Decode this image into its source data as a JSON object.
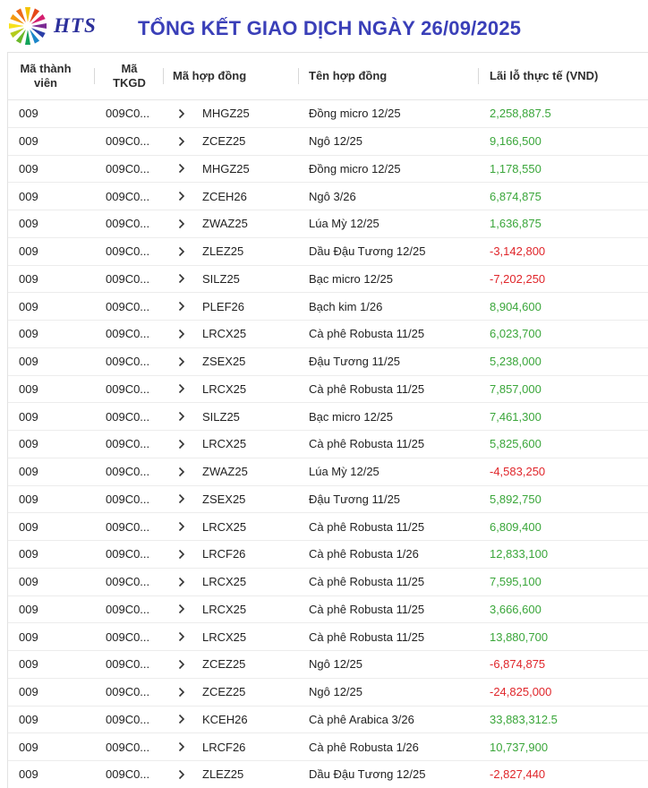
{
  "header": {
    "logo_text": "HTS",
    "title": "TỔNG KẾT GIAO DỊCH NGÀY 26/09/2025"
  },
  "columns": {
    "member": "Mã thành viên",
    "account": "Mã TKGD",
    "contract_code": "Mã hợp đồng",
    "contract_name": "Tên hợp đồng",
    "pnl": "Lãi lỗ thực tế (VND)"
  },
  "colors": {
    "positive": "#3aa63a",
    "negative": "#e0262b",
    "title": "#3a3fb8"
  },
  "rows": [
    {
      "member": "009",
      "account": "009C0...",
      "code": "MHGZ25",
      "name": "Đồng micro 12/25",
      "pnl": "2,258,887.5",
      "sign": "pos"
    },
    {
      "member": "009",
      "account": "009C0...",
      "code": "ZCEZ25",
      "name": "Ngô 12/25",
      "pnl": "9,166,500",
      "sign": "pos"
    },
    {
      "member": "009",
      "account": "009C0...",
      "code": "MHGZ25",
      "name": "Đồng micro 12/25",
      "pnl": "1,178,550",
      "sign": "pos"
    },
    {
      "member": "009",
      "account": "009C0...",
      "code": "ZCEH26",
      "name": "Ngô 3/26",
      "pnl": "6,874,875",
      "sign": "pos"
    },
    {
      "member": "009",
      "account": "009C0...",
      "code": "ZWAZ25",
      "name": "Lúa Mỳ 12/25",
      "pnl": "1,636,875",
      "sign": "pos"
    },
    {
      "member": "009",
      "account": "009C0...",
      "code": "ZLEZ25",
      "name": "Dầu Đậu Tương 12/25",
      "pnl": "-3,142,800",
      "sign": "neg"
    },
    {
      "member": "009",
      "account": "009C0...",
      "code": "SILZ25",
      "name": "Bạc micro 12/25",
      "pnl": "-7,202,250",
      "sign": "neg"
    },
    {
      "member": "009",
      "account": "009C0...",
      "code": "PLEF26",
      "name": "Bạch kim 1/26",
      "pnl": "8,904,600",
      "sign": "pos"
    },
    {
      "member": "009",
      "account": "009C0...",
      "code": "LRCX25",
      "name": "Cà phê Robusta 11/25",
      "pnl": "6,023,700",
      "sign": "pos"
    },
    {
      "member": "009",
      "account": "009C0...",
      "code": "ZSEX25",
      "name": "Đậu Tương 11/25",
      "pnl": "5,238,000",
      "sign": "pos"
    },
    {
      "member": "009",
      "account": "009C0...",
      "code": "LRCX25",
      "name": "Cà phê Robusta 11/25",
      "pnl": "7,857,000",
      "sign": "pos"
    },
    {
      "member": "009",
      "account": "009C0...",
      "code": "SILZ25",
      "name": "Bạc micro 12/25",
      "pnl": "7,461,300",
      "sign": "pos"
    },
    {
      "member": "009",
      "account": "009C0...",
      "code": "LRCX25",
      "name": "Cà phê Robusta 11/25",
      "pnl": "5,825,600",
      "sign": "pos"
    },
    {
      "member": "009",
      "account": "009C0...",
      "code": "ZWAZ25",
      "name": "Lúa Mỳ 12/25",
      "pnl": "-4,583,250",
      "sign": "neg"
    },
    {
      "member": "009",
      "account": "009C0...",
      "code": "ZSEX25",
      "name": "Đậu Tương 11/25",
      "pnl": "5,892,750",
      "sign": "pos"
    },
    {
      "member": "009",
      "account": "009C0...",
      "code": "LRCX25",
      "name": "Cà phê Robusta 11/25",
      "pnl": "6,809,400",
      "sign": "pos"
    },
    {
      "member": "009",
      "account": "009C0...",
      "code": "LRCF26",
      "name": "Cà phê Robusta 1/26",
      "pnl": "12,833,100",
      "sign": "pos"
    },
    {
      "member": "009",
      "account": "009C0...",
      "code": "LRCX25",
      "name": "Cà phê Robusta 11/25",
      "pnl": "7,595,100",
      "sign": "pos"
    },
    {
      "member": "009",
      "account": "009C0...",
      "code": "LRCX25",
      "name": "Cà phê Robusta 11/25",
      "pnl": "3,666,600",
      "sign": "pos"
    },
    {
      "member": "009",
      "account": "009C0...",
      "code": "LRCX25",
      "name": "Cà phê Robusta 11/25",
      "pnl": "13,880,700",
      "sign": "pos"
    },
    {
      "member": "009",
      "account": "009C0...",
      "code": "ZCEZ25",
      "name": "Ngô 12/25",
      "pnl": "-6,874,875",
      "sign": "neg"
    },
    {
      "member": "009",
      "account": "009C0...",
      "code": "ZCEZ25",
      "name": "Ngô 12/25",
      "pnl": "-24,825,000",
      "sign": "neg"
    },
    {
      "member": "009",
      "account": "009C0...",
      "code": "KCEH26",
      "name": "Cà phê Arabica 3/26",
      "pnl": "33,883,312.5",
      "sign": "pos"
    },
    {
      "member": "009",
      "account": "009C0...",
      "code": "LRCF26",
      "name": "Cà phê Robusta 1/26",
      "pnl": "10,737,900",
      "sign": "pos"
    },
    {
      "member": "009",
      "account": "009C0...",
      "code": "ZLEZ25",
      "name": "Dầu Đậu Tương 12/25",
      "pnl": "-2,827,440",
      "sign": "neg"
    }
  ]
}
